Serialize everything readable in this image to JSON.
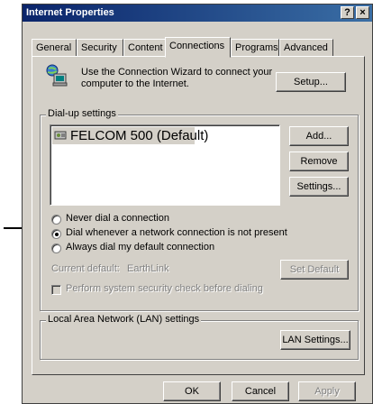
{
  "window": {
    "title": "Internet Properties",
    "help_label": "?",
    "close_label": "×"
  },
  "tabs": [
    {
      "label": "General"
    },
    {
      "label": "Security"
    },
    {
      "label": "Content"
    },
    {
      "label": "Connections",
      "active": true
    },
    {
      "label": "Programs"
    },
    {
      "label": "Advanced"
    }
  ],
  "wizard": {
    "text_line1": "Use the Connection Wizard to connect your",
    "text_line2": "computer to the Internet.",
    "setup_label": "Setup...",
    "icon": "connection-wizard-icon"
  },
  "dialup": {
    "group_title": "Dial-up settings",
    "items": [
      {
        "label": "FELCOM 500 (Default)",
        "icon": "dialup-connection-icon"
      }
    ],
    "add_label": "Add...",
    "remove_label": "Remove",
    "settings_label": "Settings...",
    "options": [
      {
        "label": "Never dial a connection",
        "selected": false
      },
      {
        "label": "Dial whenever a network connection is not present",
        "selected": true
      },
      {
        "label": "Always dial my default connection",
        "selected": false
      }
    ],
    "current_default_label": "Current default:",
    "current_default_value": "EarthLink",
    "set_default_label": "Set Default",
    "security_check_label": "Perform system security check before dialing"
  },
  "lan": {
    "group_title": "Local Area Network (LAN) settings",
    "button_label": "LAN Settings..."
  },
  "footer": {
    "ok_label": "OK",
    "cancel_label": "Cancel",
    "apply_label": "Apply"
  }
}
